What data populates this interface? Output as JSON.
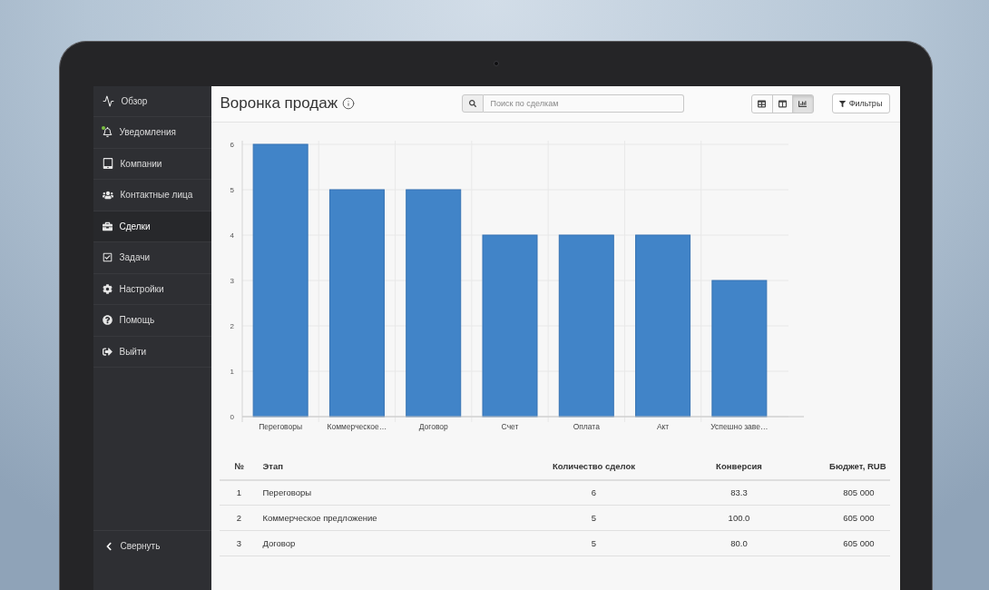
{
  "sidebar": {
    "items": [
      {
        "label": "Обзор",
        "selected": false,
        "alert": false
      },
      {
        "label": "Уведомления",
        "selected": false,
        "alert": true
      },
      {
        "label": "Компании",
        "selected": false,
        "alert": false
      },
      {
        "label": "Контактные лица",
        "selected": false,
        "alert": false
      },
      {
        "label": "Сделки",
        "selected": true,
        "alert": false
      },
      {
        "label": "Задачи",
        "selected": false,
        "alert": false
      },
      {
        "label": "Настройки",
        "selected": false,
        "alert": false
      },
      {
        "label": "Помощь",
        "selected": false,
        "alert": false
      },
      {
        "label": "Выйти",
        "selected": false,
        "alert": false
      }
    ],
    "collapse": {
      "label": "Свернуть"
    }
  },
  "header": {
    "title": "Воронка продаж",
    "search": {
      "placeholder": "Поиск по сделкам"
    },
    "views": [
      {
        "selected": false
      },
      {
        "selected": false
      },
      {
        "selected": true
      }
    ],
    "filter_button": "Фильтры"
  },
  "chart": {
    "chart_data": {
      "type": "bar",
      "categories": [
        "Переговоры",
        "Коммерческое…",
        "Договор",
        "Счет",
        "Оплата",
        "Акт",
        "Успешно заве…"
      ],
      "values": [
        6,
        5,
        5,
        4,
        4,
        4,
        3
      ],
      "ylim": [
        0,
        6
      ],
      "yticks": [
        0,
        1,
        2,
        3,
        4,
        5,
        6
      ],
      "grid": true
    }
  },
  "table": {
    "columns": [
      "№",
      "Этап",
      "Количество сделок",
      "Конверсия",
      "Бюджет, RUB"
    ],
    "rows": [
      [
        "1",
        "Переговоры",
        "6",
        "83.3",
        "805 000"
      ],
      [
        "2",
        "Коммерческое предложение",
        "5",
        "100.0",
        "605 000"
      ],
      [
        "3",
        "Договор",
        "5",
        "80.0",
        "605 000"
      ]
    ]
  }
}
